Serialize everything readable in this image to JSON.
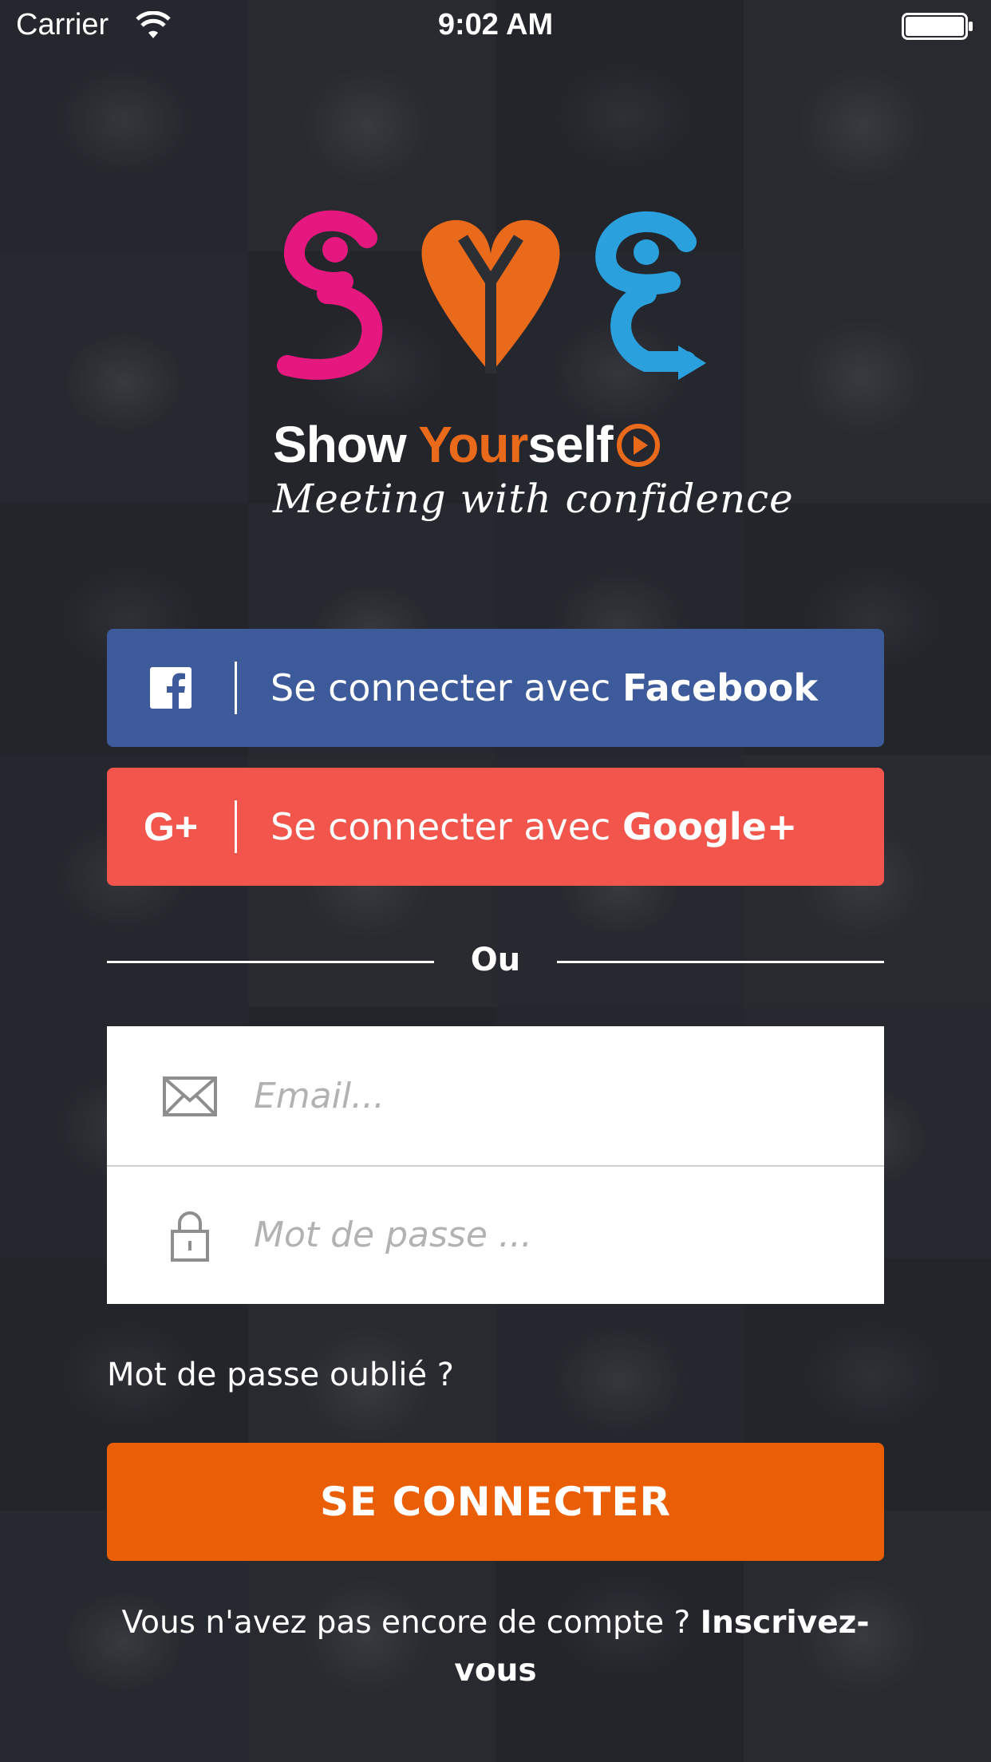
{
  "status_bar": {
    "carrier": "Carrier",
    "time": "9:02 AM",
    "wifi_icon": "wifi-icon",
    "battery_icon": "battery-icon"
  },
  "brand": {
    "name_part1": "Show ",
    "name_part2": "Your",
    "name_part3": "self",
    "tagline": "Meeting with confidence",
    "colors": {
      "pink": "#e5187f",
      "orange": "#ea6a1c",
      "blue": "#2aa0dd"
    }
  },
  "social": {
    "facebook": {
      "prefix": "Se connecter avec ",
      "brand": "Facebook",
      "icon": "facebook-icon",
      "color": "#3d5a9a"
    },
    "google": {
      "prefix": "Se connecter avec ",
      "brand": "Google+",
      "icon_text": "G+",
      "color": "#f2554b"
    }
  },
  "divider_text": "Ou",
  "form": {
    "email_placeholder": "Email...",
    "password_placeholder": "Mot de passe ..."
  },
  "forgot_password": "Mot de passe oublié ?",
  "login_button": "SE CONNECTER",
  "login_button_color": "#ea5f05",
  "signup": {
    "prefix": "Vous n'avez pas encore de compte ? ",
    "link": "Inscrivez-vous"
  }
}
